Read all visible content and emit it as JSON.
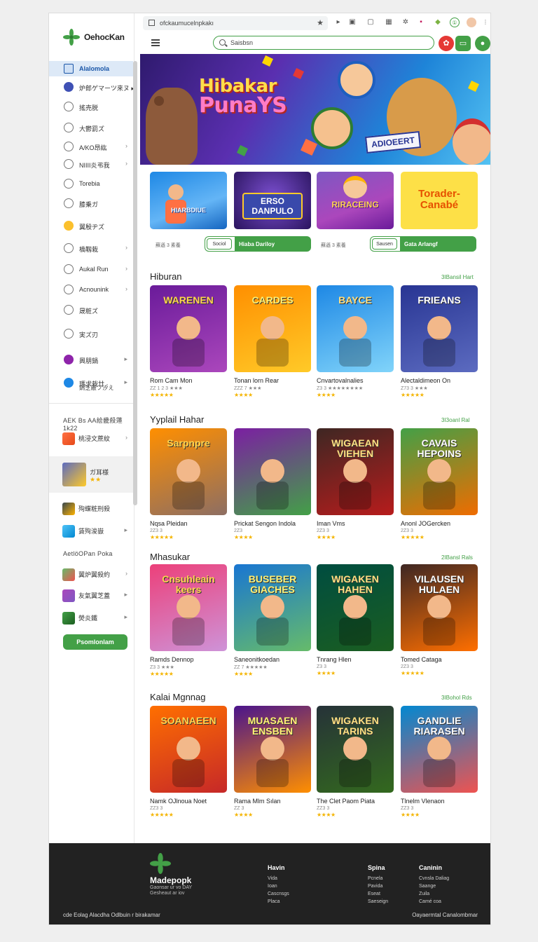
{
  "browser": {
    "url": "ofckaumucelnpkakı",
    "search_placeholder": "Saisbsn"
  },
  "logo": {
    "text": "OehocKan"
  },
  "sidebar": {
    "items": [
      {
        "label": "Alalomola",
        "chevron": ""
      },
      {
        "label": "炉郎ゲマーツ来ヌ ▸",
        "chevron": ""
      },
      {
        "label": "搖売脱",
        "chevron": ""
      },
      {
        "label": "大鬱罰ズ",
        "chevron": ""
      },
      {
        "label": "A/KO昂紘",
        "chevron": "›"
      },
      {
        "label": "NIIII炎弔我",
        "chevron": "›"
      },
      {
        "label": "Torebia",
        "chevron": ""
      },
      {
        "label": "膝乗ガ",
        "chevron": ""
      },
      {
        "label": "翼殷ヂズ",
        "chevron": ""
      },
      {
        "label": "橋靱栽",
        "chevron": "›"
      },
      {
        "label": "Aukal Run",
        "chevron": "›"
      },
      {
        "label": "Acnounink",
        "chevron": "›"
      },
      {
        "label": "晟粧ズ",
        "chevron": ""
      },
      {
        "label": "実ズ刃",
        "chevron": ""
      },
      {
        "label": "興朋鍋",
        "chevron": "▸"
      },
      {
        "label": "瑪求栽廿 ·",
        "chevron": "▸"
      }
    ],
    "sub_label_under_last": "鍋芝蔽フ汐え",
    "section1_heading": "AEK Bs AA絵畿殺蓮1k22",
    "section1_items": [
      {
        "label": "桃浸文蔗紋",
        "chevron": "›"
      },
      {
        "label": "ガ耳様",
        "chevron": ""
      },
      {
        "label": "殉蝶粧刑殺",
        "chevron": ""
      },
      {
        "label": "賃殉浚嶽",
        "chevron": "▸"
      }
    ],
    "section2_heading": "AetlöOPan Poka",
    "section2_items": [
      {
        "label": "翼炉翼殺約",
        "chevron": "›"
      },
      {
        "label": "友氣翼芝蓋",
        "chevron": "▸"
      },
      {
        "label": "熒炎鐵",
        "chevron": "▸"
      }
    ],
    "premium_button": "Psomlonlam",
    "rating_stars": "★★"
  },
  "banner": {
    "title_line1": "Hibakar",
    "title_line2": "PunaYS",
    "tag": "ADIOEERT"
  },
  "featured": [
    {
      "text": "HIARBDIUE"
    },
    {
      "text": "ERSO DANPULO"
    },
    {
      "text": "RIRACEING"
    },
    {
      "text": "Torader-Canabé"
    }
  ],
  "featured_meta": {
    "stat_left": "蘇遜 3 素養",
    "pill_left_small": "Sociol",
    "pill_left_main": "Hiaba Dariloy",
    "stat_right": "蘇遜 3 素養",
    "pill_right_small": "Sausen",
    "pill_right_main": "Gata Arlangf"
  },
  "sections": [
    {
      "title": "Hiburan",
      "more": "3IBansil Hart",
      "cards": [
        {
          "art": "WARENEN",
          "name": "Rom Cam Mon",
          "meta": "ZZ 1 2 3 ★★★",
          "stars": "★★★★★"
        },
        {
          "art": "CARDES",
          "name": "Tonan lorn Rear",
          "meta": "ZZZ 7 ★★★",
          "stars": "★★★★"
        },
        {
          "art": "BAYCE",
          "name": "Cnvartovalnalies",
          "meta": "Z3 3 ★★★★★★★★",
          "stars": "★★★★"
        },
        {
          "art": "FRIEANS",
          "name": "Alectaldimeon On",
          "meta": "Z73 3 ★★★",
          "stars": "★★★★★"
        }
      ]
    },
    {
      "title": "Yyplail Hahar",
      "more": "3I3oanl Ral",
      "cards": [
        {
          "art": "Sarpnpre",
          "name": "Nqsa Pleidan",
          "meta": "2Z3 3",
          "stars": "★★★★★"
        },
        {
          "art": "",
          "name": "Prickat Sengon Indola",
          "meta": "2Z3",
          "stars": "★★★★"
        },
        {
          "art": "WIGAEAN VIEHEN",
          "name": "Iman Vms",
          "meta": "2Z3 3",
          "stars": "★★★★"
        },
        {
          "art": "CAVAIS HEPOINS",
          "name": "Anonl JOGercken",
          "meta": "2Z3 3",
          "stars": "★★★★★"
        }
      ]
    },
    {
      "title": "Mhasukar",
      "more": "2IBansl Rals",
      "cards": [
        {
          "art": "Cnsuhleain keers",
          "name": "Ramds Dennop",
          "meta": "Z3 3 ★★★",
          "stars": "★★★★★"
        },
        {
          "art": "BUSEBER GIACHES",
          "name": "Saneonitkoedan",
          "meta": "ZZ 7 ★★★★★",
          "stars": "★★★★"
        },
        {
          "art": "WIGAKEN HAHEN",
          "name": "Tnrang Hlen",
          "meta": "Z3 3",
          "stars": "★★★★"
        },
        {
          "art": "VILAUSEN HULAEN",
          "name": "Tomed Cataga",
          "meta": "2Z3 3",
          "stars": "★★★★★"
        }
      ]
    },
    {
      "title": "Kalai Mgnnag",
      "more": "3IBohol Rds",
      "cards": [
        {
          "art": "SOANAEEN",
          "name": "Namk OJlnoua Noet",
          "meta": "ZZ3 3",
          "stars": "★★★★★"
        },
        {
          "art": "MUASAEN ENSBEN",
          "name": "Rama Mlm Sılan",
          "meta": "ZZ 3",
          "stars": "★★★★"
        },
        {
          "art": "WIGAKEN TARINS",
          "name": "The Clet Paom Piata",
          "meta": "ZZ3 3",
          "stars": "★★★★"
        },
        {
          "art": "GANDLIE RIARASEN",
          "name": "Tlnelm Vlenaon",
          "meta": "ZZ3 3",
          "stars": "★★★★"
        }
      ]
    }
  ],
  "footer": {
    "brand": "Madepopk",
    "tagline": "Gaonsar ur vo DAY",
    "tagline2": "Gesheaut ar iov",
    "col1": {
      "heading": "Havin",
      "links": [
        "Vida",
        "Ioan",
        "Cascnsgs",
        "Placa"
      ]
    },
    "col2": {
      "heading": "Spina",
      "links": [
        "Pcnela",
        "Pavida",
        "Eseat",
        "Saeseign"
      ]
    },
    "col3": {
      "heading": "Caninin",
      "links": [
        "Cvnsla Daliag",
        "Saange",
        "Zuila",
        "Camé coa"
      ]
    },
    "copyright": "cde  Eolag  Alacdha  Odlbuin  r  birakamar",
    "copyright_right": "Oayaermtal Canalombmar"
  },
  "colors": {
    "accent": "#43a047",
    "active_bg": "#dde9f7",
    "footer": "#222222"
  }
}
